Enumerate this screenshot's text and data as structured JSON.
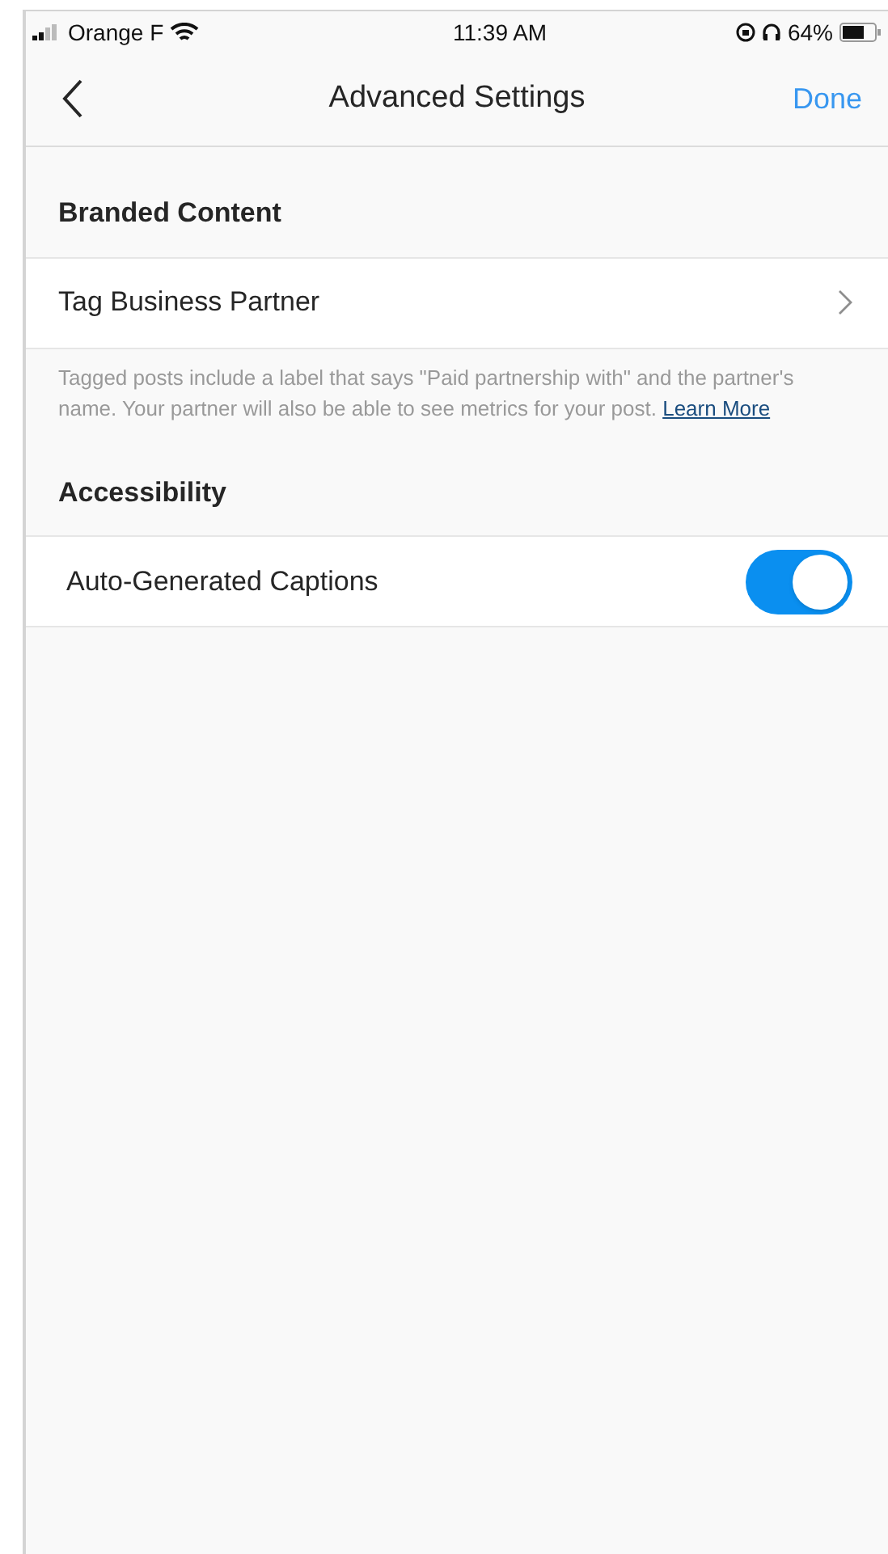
{
  "status_bar": {
    "carrier": "Orange F",
    "time": "11:39 AM",
    "battery": "64%"
  },
  "nav": {
    "title": "Advanced Settings",
    "action": "Done"
  },
  "sections": [
    {
      "header": "Branded Content",
      "rows": [
        {
          "kind": "link",
          "label": "Tag Business Partner"
        }
      ],
      "note": {
        "text": "Tagged posts include a label that says \"Paid partnership with\" and the partner's name. Your partner will also be able to see metrics for your post.",
        "link": "Learn More"
      }
    },
    {
      "header": "Accessibility",
      "rows": [
        {
          "kind": "toggle",
          "label": "Auto-Generated Captions",
          "on": true
        }
      ]
    }
  ]
}
